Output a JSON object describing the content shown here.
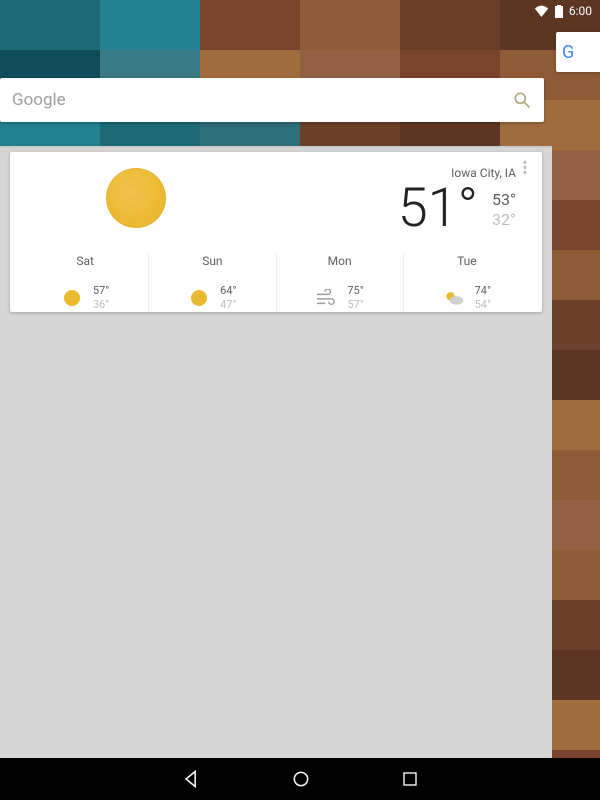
{
  "status": {
    "time": "6:00"
  },
  "search": {
    "placeholder": "Google"
  },
  "search_peek": {
    "initial": "G"
  },
  "weather": {
    "location": "Iowa City, IA",
    "current_temp": "51°",
    "hi": "53°",
    "lo": "32°",
    "condition_icon": "sun",
    "forecast": [
      {
        "day": "Sat",
        "icon": "sun",
        "hi": "57°",
        "lo": "36°"
      },
      {
        "day": "Sun",
        "icon": "sun",
        "hi": "64°",
        "lo": "47°"
      },
      {
        "day": "Mon",
        "icon": "wind",
        "hi": "75°",
        "lo": "57°"
      },
      {
        "day": "Tue",
        "icon": "partly-cloudy",
        "hi": "74°",
        "lo": "54°"
      }
    ]
  }
}
